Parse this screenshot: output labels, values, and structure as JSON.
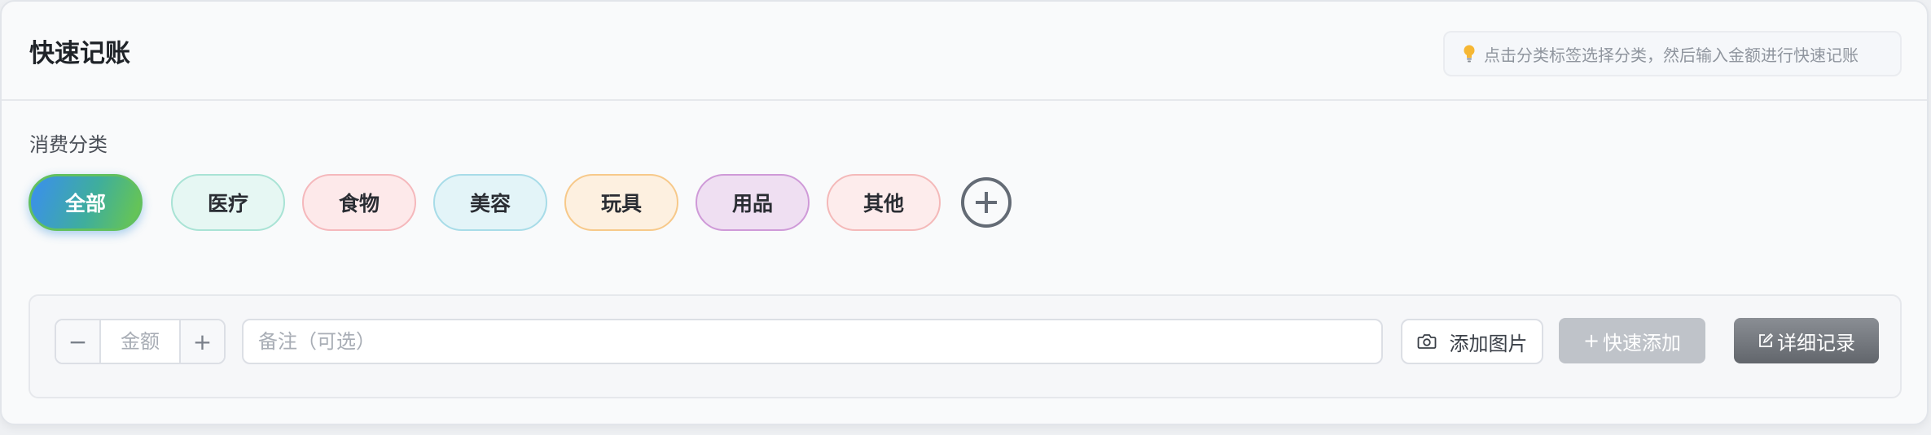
{
  "header": {
    "title": "快速记账",
    "hint": "点击分类标签选择分类，然后输入金额进行快速记账",
    "hint_icon": "lightbulb-icon"
  },
  "categories": {
    "label": "消费分类",
    "items": [
      {
        "label": "全部",
        "active": true,
        "bg": "#3fae9c",
        "border": "#62c05f"
      },
      {
        "label": "医疗",
        "active": false,
        "bg": "#e6f7f3",
        "border": "#a9e3d5"
      },
      {
        "label": "食物",
        "active": false,
        "bg": "#fde9ea",
        "border": "#f5b8bc"
      },
      {
        "label": "美容",
        "active": false,
        "bg": "#e3f4f8",
        "border": "#a8dce8"
      },
      {
        "label": "玩具",
        "active": false,
        "bg": "#fdf0e0",
        "border": "#f7c98a"
      },
      {
        "label": "用品",
        "active": false,
        "bg": "#efdff2",
        "border": "#cf9ad8"
      },
      {
        "label": "其他",
        "active": false,
        "bg": "#fdecec",
        "border": "#f4b9b9"
      }
    ],
    "add_icon": "plus-circle-icon"
  },
  "entry": {
    "minus": "−",
    "plus": "+",
    "amount_placeholder": "金额",
    "note_placeholder": "备注（可选）",
    "add_image_label": "添加图片",
    "add_image_icon": "camera-icon",
    "quick_add_glyph": "+",
    "quick_add_label": "快速添加",
    "detail_glyph": "edit-icon",
    "detail_label": "详细记录"
  }
}
